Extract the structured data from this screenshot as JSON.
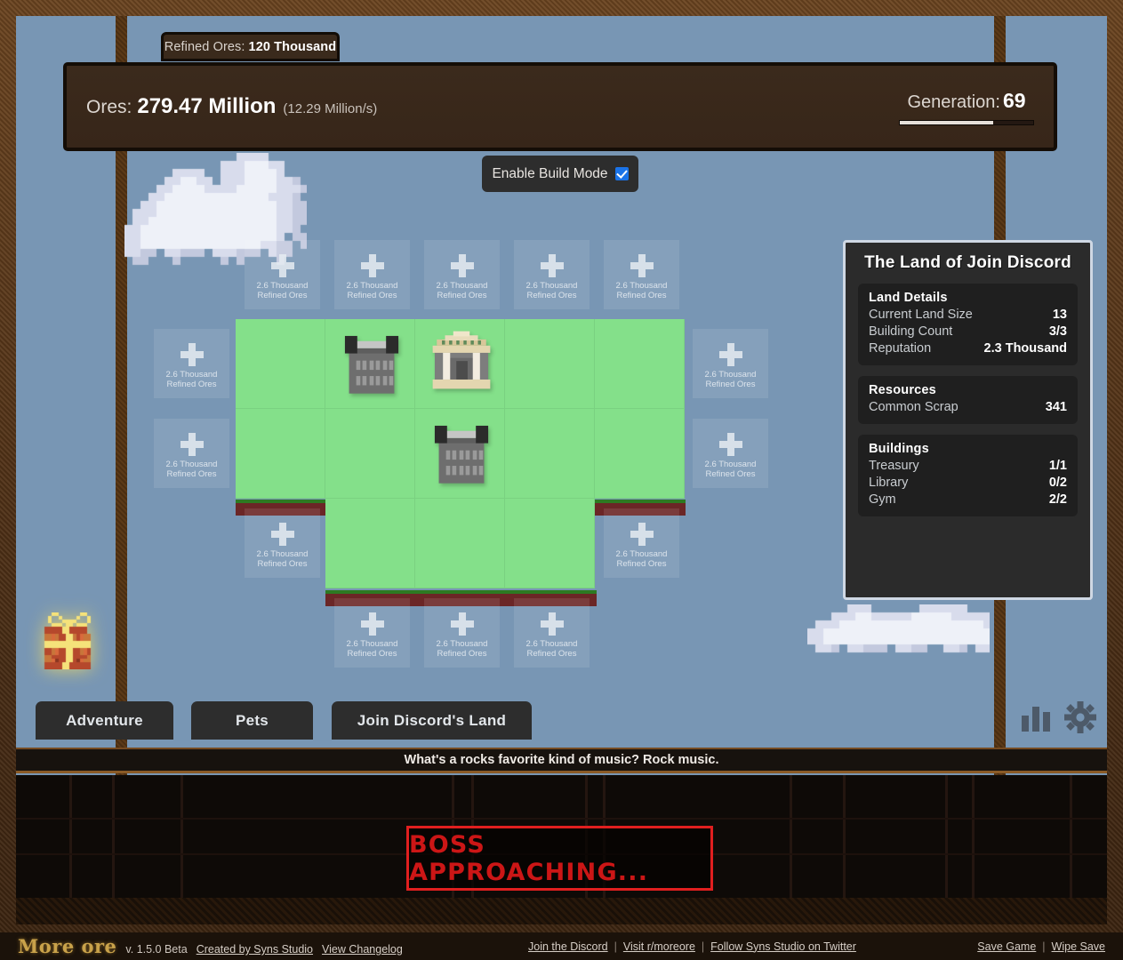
{
  "header": {
    "refined_label": "Refined Ores:",
    "refined_value": "120 Thousand",
    "ores_label": "Ores:",
    "ores_value": "279.47 Million",
    "ores_rate": "(12.29 Million/s)",
    "generation_label": "Generation:",
    "generation_value": "69",
    "generation_progress_pct": 70
  },
  "build_mode": {
    "label": "Enable Build Mode",
    "checked": true,
    "checkbox_color": "#1a73e8"
  },
  "grid": {
    "empty_tile_cost": "2.6 Thousand Refined Ores",
    "buildings": [
      {
        "type": "gym",
        "icon": "gym-building-icon"
      },
      {
        "type": "treasury",
        "icon": "treasury-building-icon"
      },
      {
        "type": "gym",
        "icon": "gym-building-icon"
      }
    ]
  },
  "land_panel": {
    "title": "The Land of Join Discord",
    "sections": [
      {
        "heading": "Land Details",
        "rows": [
          {
            "label": "Current Land Size",
            "value": "13"
          },
          {
            "label": "Building Count",
            "value": "3/3"
          },
          {
            "label": "Reputation",
            "value": "2.3 Thousand"
          }
        ]
      },
      {
        "heading": "Resources",
        "rows": [
          {
            "label": "Common Scrap",
            "value": "341"
          }
        ]
      },
      {
        "heading": "Buildings",
        "rows": [
          {
            "label": "Treasury",
            "value": "1/1"
          },
          {
            "label": "Library",
            "value": "0/2"
          },
          {
            "label": "Gym",
            "value": "2/2"
          }
        ]
      }
    ]
  },
  "tabs": [
    {
      "label": "Adventure"
    },
    {
      "label": "Pets"
    },
    {
      "label": "Join Discord's Land"
    }
  ],
  "toolbar_icons": [
    {
      "name": "stats-icon"
    },
    {
      "name": "settings-gear-icon"
    }
  ],
  "joke": "What's a rocks favorite kind of music? Rock music.",
  "boss": {
    "text": "BOSS APPROACHING...",
    "border_color": "#e01f1f",
    "text_color": "#cc1616"
  },
  "gift": {
    "name": "gift-box-icon"
  },
  "footer": {
    "logo": "More ore",
    "version": "v. 1.5.0 Beta",
    "left_links": [
      "Created by Syns Studio",
      "View Changelog"
    ],
    "center_links": [
      "Join the Discord",
      "Visit r/moreore",
      "Follow Syns Studio on Twitter"
    ],
    "right_links": [
      "Save Game",
      "Wipe Save"
    ]
  },
  "colors": {
    "sky": "#7896b4",
    "wood": "#4e3016",
    "land_green": "#84e08a",
    "grass_dark": "#2d7a22",
    "dirt": "#6b2626",
    "panel_dark": "#2b2b2b"
  }
}
